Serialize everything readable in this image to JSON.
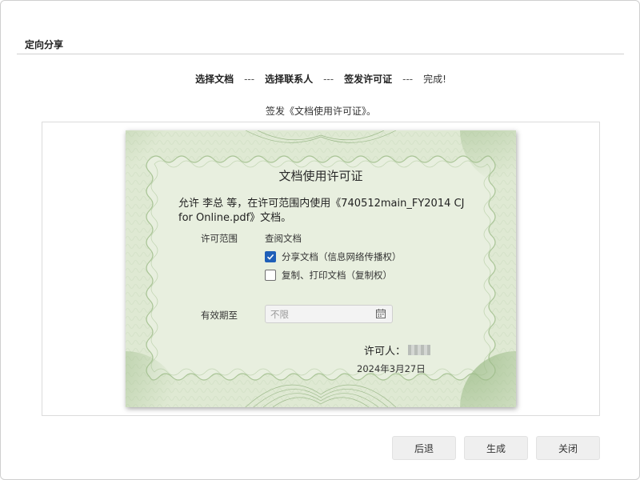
{
  "dialog": {
    "title": "定向分享"
  },
  "steps": [
    {
      "label": "选择文档"
    },
    {
      "label": "选择联系人"
    },
    {
      "label": "签发许可证"
    },
    {
      "label": "完成!"
    }
  ],
  "step_separator": "---",
  "subtitle": "签发《文档使用许可证》。",
  "certificate": {
    "title": "文档使用许可证",
    "text": "允许 李总 等，在许可范围内使用《740512main_FY2014 CJ for Online.pdf》文档。",
    "scope_label": "许可范围",
    "scope_view": "查阅文档",
    "options": [
      {
        "label": "分享文档（信息网络传播权）",
        "checked": true
      },
      {
        "label": "复制、打印文档（复制权）",
        "checked": false
      }
    ],
    "validity_label": "有效期至",
    "validity_placeholder": "不限",
    "licensor_label": "许可人：",
    "date": "2024年3月27日"
  },
  "buttons": {
    "back": "后退",
    "generate": "生成",
    "close": "关闭"
  },
  "colors": {
    "certificate_bg": "#e8efdf",
    "border_green": "#8fb07c",
    "checkbox_checked": "#1f5fb8"
  }
}
